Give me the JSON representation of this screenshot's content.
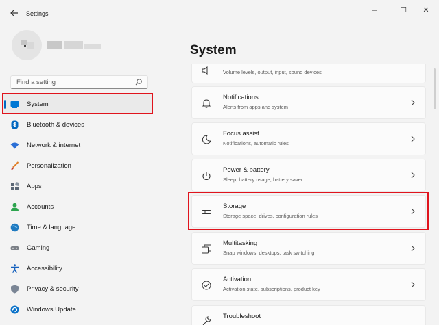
{
  "window": {
    "title": "Settings",
    "back_icon": "arrow-left-icon",
    "controls": {
      "minimize": "–",
      "maximize": "☐",
      "close": "✕"
    }
  },
  "search": {
    "placeholder": "Find a setting",
    "value": "",
    "icon": "search-icon"
  },
  "sidebar": {
    "items": [
      {
        "label": "System",
        "icon": "display-icon",
        "selected": true,
        "color": "#0078d4"
      },
      {
        "label": "Bluetooth & devices",
        "icon": "bluetooth-icon",
        "selected": false,
        "color": "#0067c0"
      },
      {
        "label": "Network & internet",
        "icon": "wifi-icon",
        "selected": false,
        "color": "#2b6fd6"
      },
      {
        "label": "Personalization",
        "icon": "brush-icon",
        "selected": false,
        "color": "#e0802a"
      },
      {
        "label": "Apps",
        "icon": "apps-icon",
        "selected": false,
        "color": "#5b6775"
      },
      {
        "label": "Accounts",
        "icon": "person-icon",
        "selected": false,
        "color": "#2da44e"
      },
      {
        "label": "Time & language",
        "icon": "globe-clock-icon",
        "selected": false,
        "color": "#1f7ac0"
      },
      {
        "label": "Gaming",
        "icon": "gamepad-icon",
        "selected": false,
        "color": "#7a7f86"
      },
      {
        "label": "Accessibility",
        "icon": "accessibility-icon",
        "selected": false,
        "color": "#1560bd"
      },
      {
        "label": "Privacy & security",
        "icon": "shield-icon",
        "selected": false,
        "color": "#7a8595"
      },
      {
        "label": "Windows Update",
        "icon": "update-icon",
        "selected": false,
        "color": "#0a72c9"
      }
    ]
  },
  "main": {
    "title": "System",
    "items": [
      {
        "title": "",
        "subtitle": "Volume levels, output, input, sound devices",
        "icon": "sound-icon"
      },
      {
        "title": "Notifications",
        "subtitle": "Alerts from apps and system",
        "icon": "bell-icon"
      },
      {
        "title": "Focus assist",
        "subtitle": "Notifications, automatic rules",
        "icon": "moon-icon"
      },
      {
        "title": "Power & battery",
        "subtitle": "Sleep, battery usage, battery saver",
        "icon": "power-icon"
      },
      {
        "title": "Storage",
        "subtitle": "Storage space, drives, configuration rules",
        "icon": "storage-icon"
      },
      {
        "title": "Multitasking",
        "subtitle": "Snap windows, desktops, task switching",
        "icon": "multitask-icon"
      },
      {
        "title": "Activation",
        "subtitle": "Activation state, subscriptions, product key",
        "icon": "check-circle-icon"
      },
      {
        "title": "Troubleshoot",
        "subtitle": "",
        "icon": "wrench-icon"
      }
    ]
  },
  "colors": {
    "accent": "#0067c0",
    "highlight": "#e0141d",
    "background": "#f3f3f3",
    "card": "#fbfbfb"
  }
}
